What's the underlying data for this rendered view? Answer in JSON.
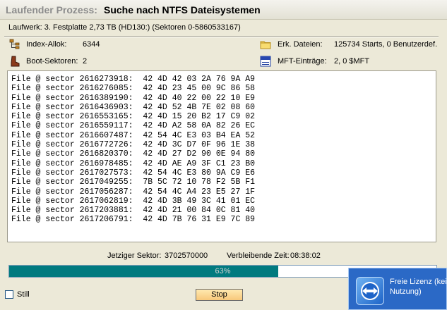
{
  "title": {
    "prefix": "Laufender Prozess:",
    "text": "Suche nach NTFS Dateisystemen"
  },
  "drive_info": "Laufwerk: 3. Festplatte 2,73 TB (HD130:) (Sektoren 0-5860533167)",
  "stats": {
    "index_alloc_label": "Index-Allok:",
    "index_alloc_value": "6344",
    "boot_sectors_label": "Boot-Sektoren:",
    "boot_sectors_value": "2",
    "found_files_label": "Erk. Dateien:",
    "found_files_value": "125734 Starts, 0 Benutzerdef.",
    "mft_entries_label": "MFT-Einträge:",
    "mft_entries_value": "2, 0 $MFT"
  },
  "log": [
    "File @ sector 2616273918:  42 4D 42 03 2A 76 9A A9",
    "File @ sector 2616276085:  42 4D 23 45 00 9C 86 58",
    "File @ sector 2616389190:  42 4D 40 22 00 22 10 E9",
    "File @ sector 2616436903:  42 4D 52 4B 7E 02 08 60",
    "File @ sector 2616553165:  42 4D 15 20 B2 17 C9 02",
    "File @ sector 2616559117:  42 4D A2 58 0A 82 26 EC",
    "File @ sector 2616607487:  42 54 4C E3 03 B4 EA 52",
    "File @ sector 2616772726:  42 4D 3C D7 0F 96 1E 38",
    "File @ sector 2616820370:  42 4D 27 D2 90 0E 94 80",
    "File @ sector 2616978485:  42 4D AE A9 3F C1 23 B0",
    "File @ sector 2617027573:  42 54 4C E3 80 9A C9 E6",
    "File @ sector 2617049255:  7B 5C 72 10 78 F2 5B F1",
    "File @ sector 2617056287:  42 54 4C A4 23 E5 27 1F",
    "File @ sector 2617062819:  42 4D 3B 49 3C 41 01 EC",
    "File @ sector 2617203881:  42 4D 21 00 84 0C 81 40",
    "File @ sector 2617206791:  42 4D 7B 76 31 E9 7C 89"
  ],
  "current_sector_label": "Jetziger Sektor:",
  "current_sector_value": "3702570000",
  "remaining_time_label": "Verbleibende Zeit:",
  "remaining_time_value": "08:38:02",
  "progress": {
    "percent": 63,
    "text": "63%"
  },
  "still_label": "Still",
  "stop_label": "Stop",
  "popup": {
    "line1": "Freie Lizenz (kein",
    "line2": "Nutzung)"
  },
  "icons": {
    "index_alloc": "tree-structure-icon",
    "boot_sectors": "boot-icon",
    "found_files": "folder-icon",
    "mft_entries": "file-icon",
    "popup_logo": "teamviewer-logo-icon"
  },
  "colors": {
    "progress_fill": "#007A7F",
    "window_bg": "#ECE9D8",
    "popup_bg": "#2B69C6"
  }
}
